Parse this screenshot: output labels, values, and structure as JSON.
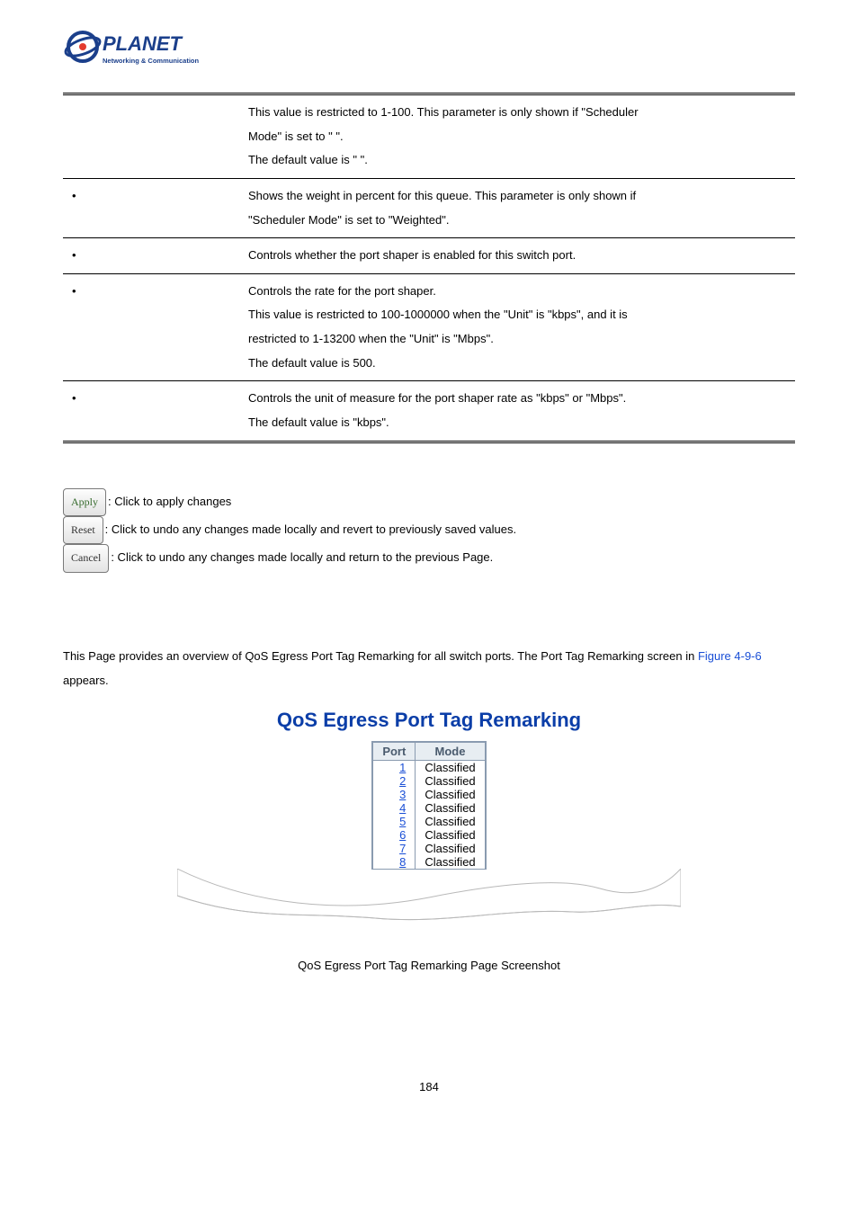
{
  "logo": {
    "brand": "PLANET",
    "tagline": "Networking & Communication"
  },
  "params": [
    {
      "label": "",
      "lines": [
        "This value is restricted to 1-100. This parameter is only shown if \"Scheduler",
        "Mode\" is set to \"                         \".",
        "The default value is \"    \"."
      ]
    },
    {
      "label": "•",
      "lines": [
        "Shows the weight in percent for this queue. This parameter is only shown if",
        "\"Scheduler Mode\" is set to \"Weighted\"."
      ]
    },
    {
      "label": "•",
      "lines": [
        "Controls whether the port shaper is enabled for this switch port."
      ]
    },
    {
      "label": "•",
      "lines": [
        "Controls the rate for the port shaper.",
        "This value is restricted to 100-1000000 when the \"Unit\" is \"kbps\", and it is",
        "restricted to 1-13200 when the \"Unit\" is \"Mbps\".",
        "The default value is 500."
      ]
    },
    {
      "label": "•",
      "lines": [
        "Controls the unit of measure for the port shaper rate as \"kbps\" or \"Mbps\".",
        "The default value is \"kbps\"."
      ]
    }
  ],
  "buttons": {
    "apply": {
      "label": "Apply",
      "desc": ": Click to apply changes"
    },
    "reset": {
      "label": "Reset",
      "desc": ": Click to undo any changes made locally and revert to previously saved values."
    },
    "cancel": {
      "label": "Cancel",
      "desc": ": Click to undo any changes made locally and return to the previous Page."
    }
  },
  "section": {
    "intro_a": "This Page provides an overview of QoS Egress Port Tag Remarking for all switch ports. The Port Tag Remarking screen in ",
    "fig_ref": "Figure 4-9-6",
    "intro_b": " appears.",
    "title": "QoS Egress Port Tag Remarking",
    "headers": {
      "port": "Port",
      "mode": "Mode"
    },
    "rows": [
      {
        "port": "1",
        "mode": "Classified"
      },
      {
        "port": "2",
        "mode": "Classified"
      },
      {
        "port": "3",
        "mode": "Classified"
      },
      {
        "port": "4",
        "mode": "Classified"
      },
      {
        "port": "5",
        "mode": "Classified"
      },
      {
        "port": "6",
        "mode": "Classified"
      },
      {
        "port": "7",
        "mode": "Classified"
      },
      {
        "port": "8",
        "mode": "Classified"
      }
    ],
    "caption": "QoS Egress Port Tag Remarking Page Screenshot"
  },
  "page_number": "184"
}
